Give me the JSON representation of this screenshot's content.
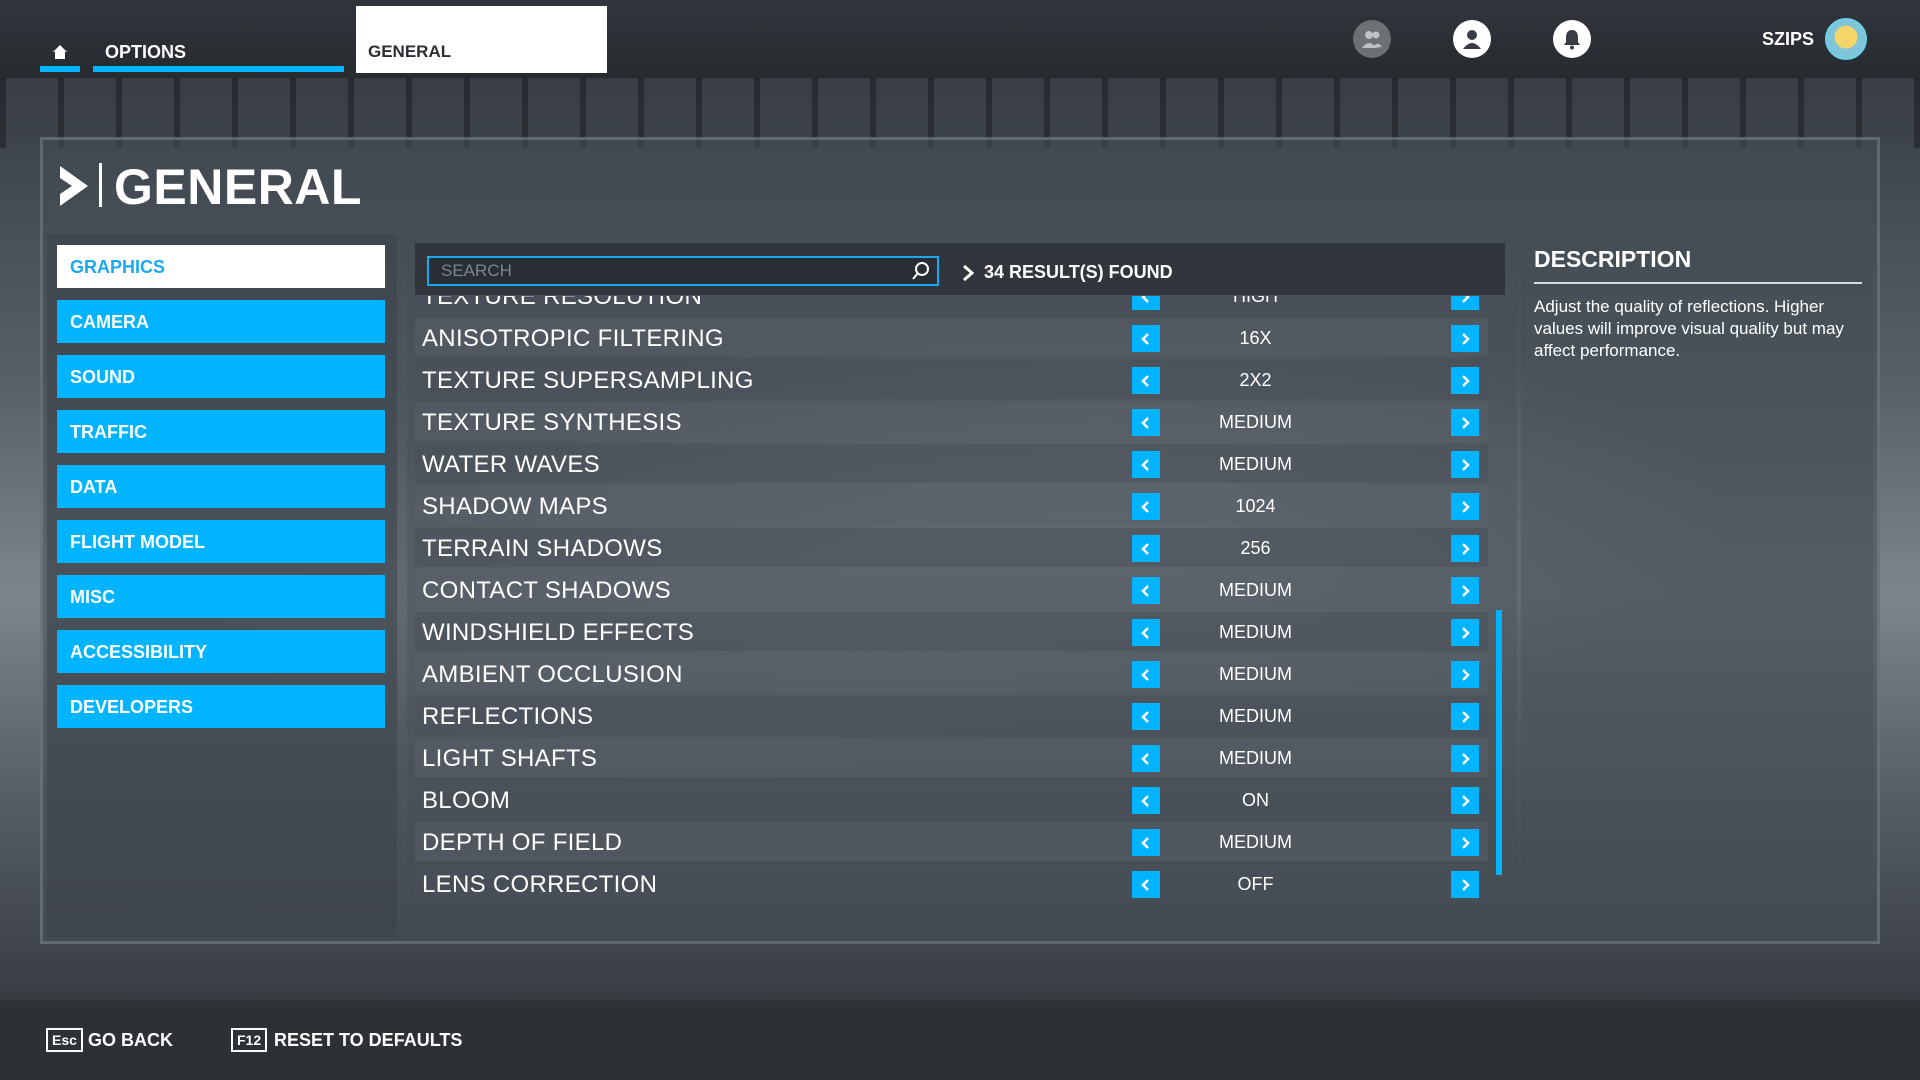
{
  "topbar": {
    "options_label": "OPTIONS",
    "general_label": "GENERAL",
    "username": "SZIPS",
    "icons": [
      "friends-icon",
      "profile-icon",
      "notifications-icon"
    ]
  },
  "page": {
    "title": "GENERAL"
  },
  "sidebar": {
    "items": [
      {
        "label": "GRAPHICS",
        "active": true
      },
      {
        "label": "CAMERA"
      },
      {
        "label": "SOUND"
      },
      {
        "label": "TRAFFIC"
      },
      {
        "label": "DATA"
      },
      {
        "label": "FLIGHT MODEL"
      },
      {
        "label": "MISC"
      },
      {
        "label": "ACCESSIBILITY"
      },
      {
        "label": "DEVELOPERS"
      }
    ]
  },
  "search": {
    "placeholder": "SEARCH",
    "results": "34 RESULT(S) FOUND"
  },
  "settings": [
    {
      "label": "TEXTURE RESOLUTION",
      "value": "HIGH"
    },
    {
      "label": "ANISOTROPIC FILTERING",
      "value": "16X"
    },
    {
      "label": "TEXTURE SUPERSAMPLING",
      "value": "2X2"
    },
    {
      "label": "TEXTURE SYNTHESIS",
      "value": "MEDIUM"
    },
    {
      "label": "WATER WAVES",
      "value": "MEDIUM"
    },
    {
      "label": "SHADOW MAPS",
      "value": "1024"
    },
    {
      "label": "TERRAIN SHADOWS",
      "value": "256"
    },
    {
      "label": "CONTACT SHADOWS",
      "value": "MEDIUM"
    },
    {
      "label": "WINDSHIELD EFFECTS",
      "value": "MEDIUM"
    },
    {
      "label": "AMBIENT OCCLUSION",
      "value": "MEDIUM"
    },
    {
      "label": "REFLECTIONS",
      "value": "MEDIUM"
    },
    {
      "label": "LIGHT SHAFTS",
      "value": "MEDIUM"
    },
    {
      "label": "BLOOM",
      "value": "ON"
    },
    {
      "label": "DEPTH OF FIELD",
      "value": "MEDIUM"
    },
    {
      "label": "LENS CORRECTION",
      "value": "OFF"
    }
  ],
  "description": {
    "title": "DESCRIPTION",
    "text": "Adjust the quality of reflections. Higher values will improve visual quality but may affect performance."
  },
  "footer": {
    "back_key": "Esc",
    "back_label": "GO BACK",
    "reset_key": "F12",
    "reset_label": "RESET TO DEFAULTS"
  },
  "colors": {
    "accent": "#00b4ff"
  }
}
